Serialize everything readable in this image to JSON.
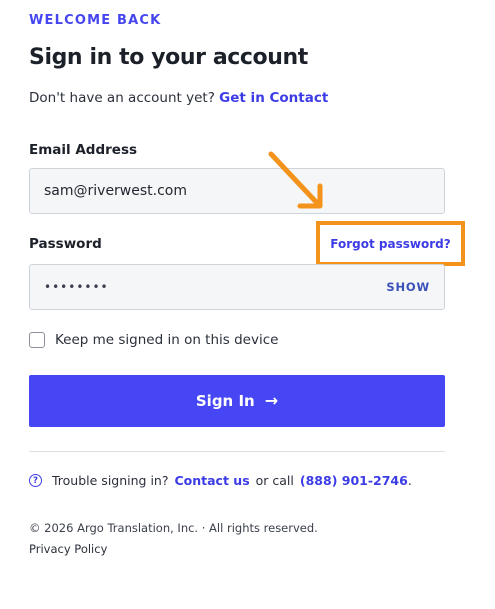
{
  "header": {
    "eyebrow": "WELCOME BACK",
    "title": "Sign in to your account",
    "subtitle_text": "Don't have an account yet?",
    "subtitle_link": "Get in Contact"
  },
  "form": {
    "email_label": "Email Address",
    "email_value": "sam@riverwest.com",
    "password_label": "Password",
    "password_masked": "••••••••",
    "show_label": "SHOW",
    "forgot_label": "Forgot password?",
    "remember_label": "Keep me signed in on this device",
    "remember_checked": false,
    "submit_label": "Sign In",
    "submit_icon": "arrow-right-icon"
  },
  "help": {
    "prefix": "Trouble signing in?",
    "contact_link": "Contact us",
    "middle": "or call",
    "phone": "(888) 901-2746",
    "suffix": "."
  },
  "footer": {
    "copyright": "© 2026 Argo Translation, Inc. · All rights reserved.",
    "privacy": "Privacy Policy"
  },
  "colors": {
    "accent": "#4646f5",
    "highlight": "#f3931c"
  }
}
